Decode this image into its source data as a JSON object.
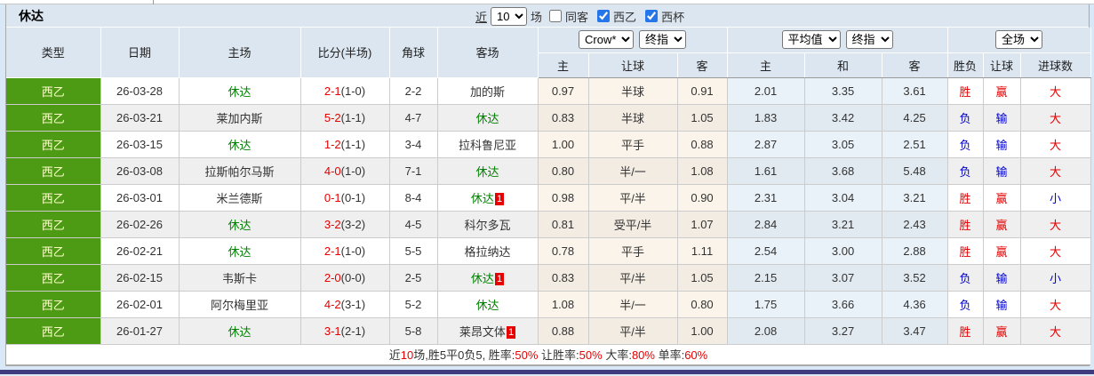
{
  "page": {
    "team_title": "休达"
  },
  "toolbar": {
    "recent_label": "近",
    "recent_count": "10",
    "matches_label": "场",
    "filters": [
      {
        "label": "同客",
        "checked": false
      },
      {
        "label": "西乙",
        "checked": true
      },
      {
        "label": "西杯",
        "checked": true
      }
    ]
  },
  "header": {
    "columns": {
      "type": "类型",
      "date": "日期",
      "home": "主场",
      "score": "比分(半场)",
      "corner": "角球",
      "away": "客场",
      "sub_home1": "主",
      "sub_line": "让球",
      "sub_away1": "客",
      "sub_home2": "主",
      "sub_draw": "和",
      "sub_away2": "客",
      "sub_winloss": "胜负",
      "sub_handicap": "让球",
      "sub_goals": "进球数"
    },
    "selects": {
      "bookmaker": "Crow*",
      "bookmaker_stage": "终指",
      "average": "平均值",
      "average_stage": "终指",
      "scope": "全场"
    }
  },
  "rows": [
    {
      "league": "西乙",
      "date": "26-03-28",
      "home": {
        "name": "休达",
        "self": true,
        "badge": ""
      },
      "score": {
        "full": "2-1",
        "half": "(1-0)"
      },
      "corner": "2-2",
      "away": {
        "name": "加的斯",
        "self": false,
        "badge": ""
      },
      "let": {
        "home": "0.97",
        "line": "半球",
        "away": "0.91"
      },
      "avg": {
        "home": "2.01",
        "draw": "3.35",
        "away": "3.61"
      },
      "result": {
        "wl": {
          "text": "胜",
          "color": "red"
        },
        "handicap": {
          "text": "赢",
          "color": "red"
        },
        "goals": {
          "text": "大",
          "color": "red"
        }
      }
    },
    {
      "league": "西乙",
      "date": "26-03-21",
      "home": {
        "name": "莱加内斯",
        "self": false,
        "badge": ""
      },
      "score": {
        "full": "5-2",
        "half": "(1-1)"
      },
      "corner": "4-7",
      "away": {
        "name": "休达",
        "self": true,
        "badge": ""
      },
      "let": {
        "home": "0.83",
        "line": "半球",
        "away": "1.05"
      },
      "avg": {
        "home": "1.83",
        "draw": "3.42",
        "away": "4.25"
      },
      "result": {
        "wl": {
          "text": "负",
          "color": "blue"
        },
        "handicap": {
          "text": "输",
          "color": "blue"
        },
        "goals": {
          "text": "大",
          "color": "red"
        }
      }
    },
    {
      "league": "西乙",
      "date": "26-03-15",
      "home": {
        "name": "休达",
        "self": true,
        "badge": ""
      },
      "score": {
        "full": "1-2",
        "half": "(1-1)"
      },
      "corner": "3-4",
      "away": {
        "name": "拉科鲁尼亚",
        "self": false,
        "badge": ""
      },
      "let": {
        "home": "1.00",
        "line": "平手",
        "away": "0.88"
      },
      "avg": {
        "home": "2.87",
        "draw": "3.05",
        "away": "2.51"
      },
      "result": {
        "wl": {
          "text": "负",
          "color": "blue"
        },
        "handicap": {
          "text": "输",
          "color": "blue"
        },
        "goals": {
          "text": "大",
          "color": "red"
        }
      }
    },
    {
      "league": "西乙",
      "date": "26-03-08",
      "home": {
        "name": "拉斯帕尔马斯",
        "self": false,
        "badge": ""
      },
      "score": {
        "full": "4-0",
        "half": "(1-0)"
      },
      "corner": "7-1",
      "away": {
        "name": "休达",
        "self": true,
        "badge": ""
      },
      "let": {
        "home": "0.80",
        "line": "半/一",
        "away": "1.08"
      },
      "avg": {
        "home": "1.61",
        "draw": "3.68",
        "away": "5.48"
      },
      "result": {
        "wl": {
          "text": "负",
          "color": "blue"
        },
        "handicap": {
          "text": "输",
          "color": "blue"
        },
        "goals": {
          "text": "大",
          "color": "red"
        }
      }
    },
    {
      "league": "西乙",
      "date": "26-03-01",
      "home": {
        "name": "米兰德斯",
        "self": false,
        "badge": ""
      },
      "score": {
        "full": "0-1",
        "half": "(0-1)"
      },
      "corner": "8-4",
      "away": {
        "name": "休达",
        "self": true,
        "badge": "1"
      },
      "let": {
        "home": "0.98",
        "line": "平/半",
        "away": "0.90"
      },
      "avg": {
        "home": "2.31",
        "draw": "3.04",
        "away": "3.21"
      },
      "result": {
        "wl": {
          "text": "胜",
          "color": "red"
        },
        "handicap": {
          "text": "赢",
          "color": "red"
        },
        "goals": {
          "text": "小",
          "color": "blue"
        }
      }
    },
    {
      "league": "西乙",
      "date": "26-02-26",
      "home": {
        "name": "休达",
        "self": true,
        "badge": ""
      },
      "score": {
        "full": "3-2",
        "half": "(3-2)"
      },
      "corner": "4-5",
      "away": {
        "name": "科尔多瓦",
        "self": false,
        "badge": ""
      },
      "let": {
        "home": "0.81",
        "line": "受平/半",
        "away": "1.07"
      },
      "avg": {
        "home": "2.84",
        "draw": "3.21",
        "away": "2.43"
      },
      "result": {
        "wl": {
          "text": "胜",
          "color": "red"
        },
        "handicap": {
          "text": "赢",
          "color": "red"
        },
        "goals": {
          "text": "大",
          "color": "red"
        }
      }
    },
    {
      "league": "西乙",
      "date": "26-02-21",
      "home": {
        "name": "休达",
        "self": true,
        "badge": ""
      },
      "score": {
        "full": "2-1",
        "half": "(1-0)"
      },
      "corner": "5-5",
      "away": {
        "name": "格拉纳达",
        "self": false,
        "badge": ""
      },
      "let": {
        "home": "0.78",
        "line": "平手",
        "away": "1.11"
      },
      "avg": {
        "home": "2.54",
        "draw": "3.00",
        "away": "2.88"
      },
      "result": {
        "wl": {
          "text": "胜",
          "color": "red"
        },
        "handicap": {
          "text": "赢",
          "color": "red"
        },
        "goals": {
          "text": "大",
          "color": "red"
        }
      }
    },
    {
      "league": "西乙",
      "date": "26-02-15",
      "home": {
        "name": "韦斯卡",
        "self": false,
        "badge": ""
      },
      "score": {
        "full": "2-0",
        "half": "(0-0)"
      },
      "corner": "2-5",
      "away": {
        "name": "休达",
        "self": true,
        "badge": "1"
      },
      "let": {
        "home": "0.83",
        "line": "平/半",
        "away": "1.05"
      },
      "avg": {
        "home": "2.15",
        "draw": "3.07",
        "away": "3.52"
      },
      "result": {
        "wl": {
          "text": "负",
          "color": "blue"
        },
        "handicap": {
          "text": "输",
          "color": "blue"
        },
        "goals": {
          "text": "小",
          "color": "blue"
        }
      }
    },
    {
      "league": "西乙",
      "date": "26-02-01",
      "home": {
        "name": "阿尔梅里亚",
        "self": false,
        "badge": ""
      },
      "score": {
        "full": "4-2",
        "half": "(3-1)"
      },
      "corner": "5-2",
      "away": {
        "name": "休达",
        "self": true,
        "badge": ""
      },
      "let": {
        "home": "1.08",
        "line": "半/一",
        "away": "0.80"
      },
      "avg": {
        "home": "1.75",
        "draw": "3.66",
        "away": "4.36"
      },
      "result": {
        "wl": {
          "text": "负",
          "color": "blue"
        },
        "handicap": {
          "text": "输",
          "color": "blue"
        },
        "goals": {
          "text": "大",
          "color": "red"
        }
      }
    },
    {
      "league": "西乙",
      "date": "26-01-27",
      "home": {
        "name": "休达",
        "self": true,
        "badge": ""
      },
      "score": {
        "full": "3-1",
        "half": "(2-1)"
      },
      "corner": "5-8",
      "away": {
        "name": "莱昂文体",
        "self": false,
        "badge": "1"
      },
      "let": {
        "home": "0.88",
        "line": "平/半",
        "away": "1.00"
      },
      "avg": {
        "home": "2.08",
        "draw": "3.27",
        "away": "3.47"
      },
      "result": {
        "wl": {
          "text": "胜",
          "color": "red"
        },
        "handicap": {
          "text": "赢",
          "color": "red"
        },
        "goals": {
          "text": "大",
          "color": "red"
        }
      }
    }
  ],
  "footer": {
    "segments": [
      {
        "text": "近",
        "red": false
      },
      {
        "text": "10",
        "red": true
      },
      {
        "text": "场,胜5平0负5, 胜率:",
        "red": false
      },
      {
        "text": "50%",
        "red": true
      },
      {
        "text": " 让胜率:",
        "red": false
      },
      {
        "text": "50%",
        "red": true
      },
      {
        "text": " 大率:",
        "red": false
      },
      {
        "text": "80%",
        "red": true
      },
      {
        "text": " 单率:",
        "red": false
      },
      {
        "text": "60%",
        "red": true
      }
    ]
  },
  "colors": {
    "league_cell_bg": "#4d9b14",
    "league_cell_text": "#ffffcc",
    "self_team": "#008000",
    "win_red": "#e60000",
    "loss_blue": "#0000cc",
    "header_bg": "#dce6f1",
    "handicap_col_bg": "#fbf4ea",
    "avg_col_bg": "#e9f2f9",
    "bottom_bar": "#3e3c7e"
  }
}
